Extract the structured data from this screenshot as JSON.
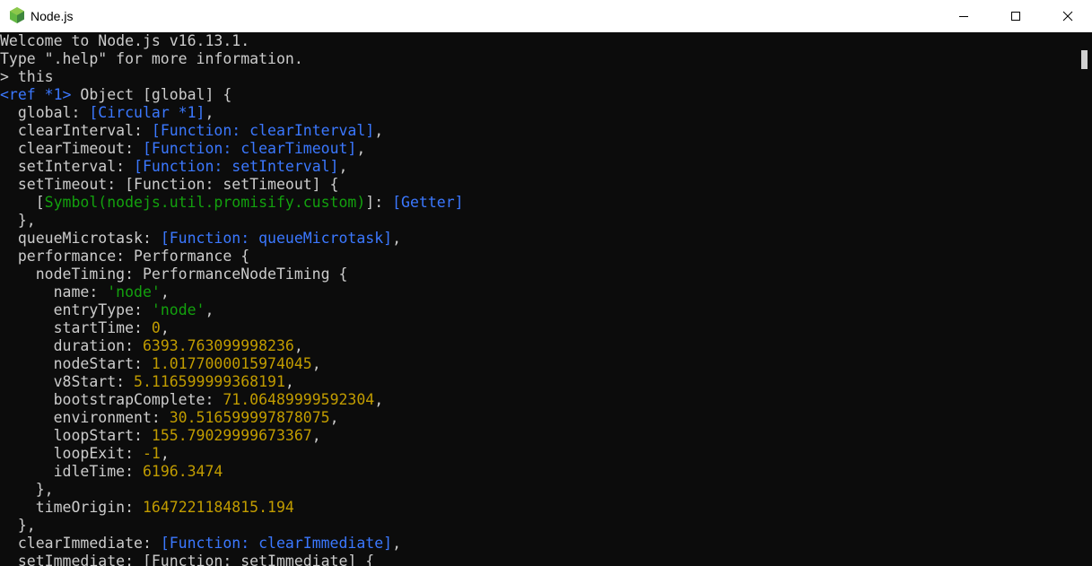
{
  "window": {
    "title": "Node.js",
    "accent": "#63b842"
  },
  "terminal": {
    "lines": [
      [
        {
          "t": "Welcome to Node.js v16.13.1.",
          "c": "default"
        }
      ],
      [
        {
          "t": "Type \".help\" for more information.",
          "c": "default"
        }
      ],
      [
        {
          "t": "> this",
          "c": "default"
        }
      ],
      [
        {
          "t": "<ref *1>",
          "c": "blue"
        },
        {
          "t": " Object [global] {",
          "c": "default"
        }
      ],
      [
        {
          "t": "  global: ",
          "c": "default"
        },
        {
          "t": "[Circular *1]",
          "c": "blue"
        },
        {
          "t": ",",
          "c": "default"
        }
      ],
      [
        {
          "t": "  clearInterval: ",
          "c": "default"
        },
        {
          "t": "[Function: clearInterval]",
          "c": "blue"
        },
        {
          "t": ",",
          "c": "default"
        }
      ],
      [
        {
          "t": "  clearTimeout: ",
          "c": "default"
        },
        {
          "t": "[Function: clearTimeout]",
          "c": "blue"
        },
        {
          "t": ",",
          "c": "default"
        }
      ],
      [
        {
          "t": "  setInterval: ",
          "c": "default"
        },
        {
          "t": "[Function: setInterval]",
          "c": "blue"
        },
        {
          "t": ",",
          "c": "default"
        }
      ],
      [
        {
          "t": "  setTimeout: [Function: setTimeout] {",
          "c": "default"
        }
      ],
      [
        {
          "t": "    [",
          "c": "default"
        },
        {
          "t": "Symbol(nodejs.util.promisify.custom)",
          "c": "green"
        },
        {
          "t": "]: ",
          "c": "default"
        },
        {
          "t": "[Getter]",
          "c": "blue"
        }
      ],
      [
        {
          "t": "  },",
          "c": "default"
        }
      ],
      [
        {
          "t": "  queueMicrotask: ",
          "c": "default"
        },
        {
          "t": "[Function: queueMicrotask]",
          "c": "blue"
        },
        {
          "t": ",",
          "c": "default"
        }
      ],
      [
        {
          "t": "  performance: Performance {",
          "c": "default"
        }
      ],
      [
        {
          "t": "    nodeTiming: PerformanceNodeTiming {",
          "c": "default"
        }
      ],
      [
        {
          "t": "      name: ",
          "c": "default"
        },
        {
          "t": "'node'",
          "c": "green"
        },
        {
          "t": ",",
          "c": "default"
        }
      ],
      [
        {
          "t": "      entryType: ",
          "c": "default"
        },
        {
          "t": "'node'",
          "c": "green"
        },
        {
          "t": ",",
          "c": "default"
        }
      ],
      [
        {
          "t": "      startTime: ",
          "c": "default"
        },
        {
          "t": "0",
          "c": "yellow"
        },
        {
          "t": ",",
          "c": "default"
        }
      ],
      [
        {
          "t": "      duration: ",
          "c": "default"
        },
        {
          "t": "6393.763099998236",
          "c": "yellow"
        },
        {
          "t": ",",
          "c": "default"
        }
      ],
      [
        {
          "t": "      nodeStart: ",
          "c": "default"
        },
        {
          "t": "1.0177000015974045",
          "c": "yellow"
        },
        {
          "t": ",",
          "c": "default"
        }
      ],
      [
        {
          "t": "      v8Start: ",
          "c": "default"
        },
        {
          "t": "5.116599999368191",
          "c": "yellow"
        },
        {
          "t": ",",
          "c": "default"
        }
      ],
      [
        {
          "t": "      bootstrapComplete: ",
          "c": "default"
        },
        {
          "t": "71.06489999592304",
          "c": "yellow"
        },
        {
          "t": ",",
          "c": "default"
        }
      ],
      [
        {
          "t": "      environment: ",
          "c": "default"
        },
        {
          "t": "30.516599997878075",
          "c": "yellow"
        },
        {
          "t": ",",
          "c": "default"
        }
      ],
      [
        {
          "t": "      loopStart: ",
          "c": "default"
        },
        {
          "t": "155.79029999673367",
          "c": "yellow"
        },
        {
          "t": ",",
          "c": "default"
        }
      ],
      [
        {
          "t": "      loopExit: ",
          "c": "default"
        },
        {
          "t": "-1",
          "c": "yellow"
        },
        {
          "t": ",",
          "c": "default"
        }
      ],
      [
        {
          "t": "      idleTime: ",
          "c": "default"
        },
        {
          "t": "6196.3474",
          "c": "yellow"
        }
      ],
      [
        {
          "t": "    },",
          "c": "default"
        }
      ],
      [
        {
          "t": "    timeOrigin: ",
          "c": "default"
        },
        {
          "t": "1647221184815.194",
          "c": "yellow"
        }
      ],
      [
        {
          "t": "  },",
          "c": "default"
        }
      ],
      [
        {
          "t": "  clearImmediate: ",
          "c": "default"
        },
        {
          "t": "[Function: clearImmediate]",
          "c": "blue"
        },
        {
          "t": ",",
          "c": "default"
        }
      ],
      [
        {
          "t": "  setImmediate: [Function: setImmediate] {",
          "c": "default"
        }
      ]
    ]
  }
}
